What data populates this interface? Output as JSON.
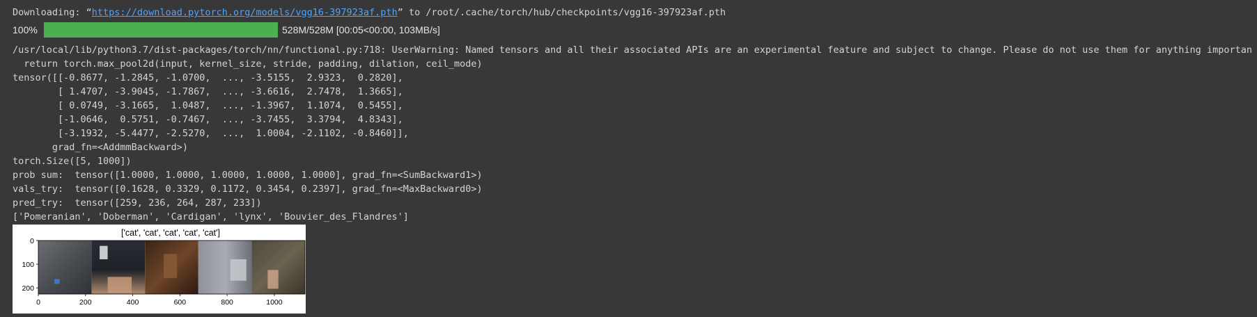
{
  "download": {
    "prefix": "Downloading: “",
    "url": "https://download.pytorch.org/models/vgg16-397923af.pth",
    "suffix": "” to /root/.cache/torch/hub/checkpoints/vgg16-397923af.pth"
  },
  "progress": {
    "percent_label": "100%",
    "fraction": 1.0,
    "stats": "528M/528M [00:05<00:00, 103MB/s]",
    "color": "#4caf50"
  },
  "warning": {
    "line1": "/usr/local/lib/python3.7/dist-packages/torch/nn/functional.py:718: UserWarning: Named tensors and all their associated APIs are an experimental feature and subject to change. Please do not use them for anything important un",
    "line2": "  return torch.max_pool2d(input, kernel_size, stride, padding, dilation, ceil_mode)"
  },
  "tensor_lines": [
    "tensor([[-0.8677, -1.2845, -1.0700,  ..., -3.5155,  2.9323,  0.2820],",
    "        [ 1.4707, -3.9045, -1.7867,  ..., -3.6616,  2.7478,  1.3665],",
    "        [ 0.0749, -3.1665,  1.0487,  ..., -1.3967,  1.1074,  0.5455],",
    "        [-1.0646,  0.5751, -0.7467,  ..., -3.7455,  3.3794,  4.8343],",
    "        [-3.1932, -5.4477, -2.5270,  ...,  1.0004, -2.1102, -0.8460]],",
    "       grad_fn=<AddmmBackward>)"
  ],
  "size_line": "torch.Size([5, 1000])",
  "prob_line": "prob sum:  tensor([1.0000, 1.0000, 1.0000, 1.0000, 1.0000], grad_fn=<SumBackward1>)",
  "vals_line": "vals_try:  tensor([0.1628, 0.3329, 0.1172, 0.3454, 0.2397], grad_fn=<MaxBackward0>)",
  "pred_line": "pred_try:  tensor([259, 236, 264, 287, 233])",
  "labels_line": "['Pomeranian', 'Doberman', 'Cardigan', 'lynx', 'Bouvier_des_Flandres']",
  "figure": {
    "title": "['cat', 'cat', 'cat', 'cat', 'cat']",
    "y_ticks": [
      "0",
      "100",
      "200"
    ],
    "x_ticks": [
      "0",
      "200",
      "400",
      "600",
      "800",
      "1000"
    ],
    "x_range": [
      0,
      1130
    ],
    "y_range": [
      0,
      226
    ],
    "x_tick_values": [
      0,
      200,
      400,
      600,
      800,
      1000
    ],
    "y_tick_values": [
      0,
      100,
      200
    ]
  }
}
